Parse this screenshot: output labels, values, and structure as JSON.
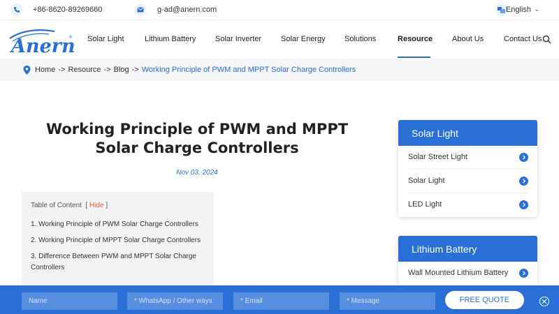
{
  "topbar": {
    "phone": "+86-8620-89269660",
    "email": "g-ad@anern.com",
    "language": "English"
  },
  "nav": {
    "brand": "Anern",
    "items": [
      "Solar Light",
      "Lithium Battery",
      "Solar Inverter",
      "Solar Energy",
      "Solutions",
      "Resource",
      "About Us",
      "Contact Us"
    ],
    "active": "Resource"
  },
  "breadcrumb": {
    "items": [
      "Home",
      "Resource",
      "Blog"
    ],
    "separator": "->",
    "current": "Working Principle of PWM and MPPT Solar Charge Controllers"
  },
  "article": {
    "title_line1": "Working Principle of PWM and MPPT",
    "title_line2": "Solar Charge Controllers",
    "date": "Nov 03, 2024"
  },
  "toc": {
    "label": "Table of Content",
    "open_bracket": "[",
    "hide": "Hide",
    "close_bracket": "]",
    "items": [
      "1. Working Principle of PWM Solar Charge Controllers",
      "2. Working Principle of MPPT Solar Charge Controllers",
      "3. Difference Between PWM and MPPT Solar Charge Controllers"
    ]
  },
  "sidebar": [
    {
      "heading": "Solar Light",
      "items": [
        "Solar Street Light",
        "Solar Light",
        "LED Light"
      ]
    },
    {
      "heading": "Lithium Battery",
      "items": [
        "Wall Mounted Lithium Battery"
      ]
    }
  ],
  "quote": {
    "name_placeholder": "Name",
    "whatsapp_placeholder": "* WhatsApp / Other ways",
    "email_placeholder": "* Email",
    "message_placeholder": "* Message",
    "button": "FREE QUOTE"
  },
  "colors": {
    "accent": "#2a6fd6",
    "toc_hide": "#e0602a",
    "breadcrumb_bg": "#f5f6f8"
  }
}
